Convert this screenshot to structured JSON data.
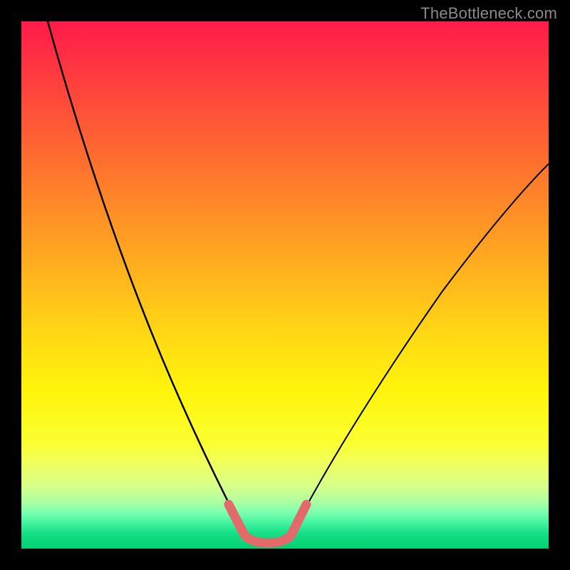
{
  "watermark": "TheBottleneck.com",
  "chart_data": {
    "type": "line",
    "title": "",
    "xlabel": "",
    "ylabel": "",
    "xlim": [
      0,
      100
    ],
    "ylim": [
      0,
      100
    ],
    "series": [
      {
        "name": "left-curve",
        "x": [
          5,
          8,
          12,
          16,
          20,
          24,
          28,
          32,
          35,
          37,
          39,
          40,
          41,
          42
        ],
        "y": [
          100,
          88,
          74,
          62,
          51,
          40,
          30,
          21,
          13,
          9,
          6,
          4,
          3,
          2
        ]
      },
      {
        "name": "right-curve",
        "x": [
          48,
          49,
          50,
          52,
          55,
          60,
          66,
          74,
          82,
          90,
          98,
          100
        ],
        "y": [
          2,
          3,
          4,
          6,
          10,
          17,
          25,
          35,
          45,
          54,
          62,
          64
        ]
      },
      {
        "name": "valley-highlight",
        "x": [
          39,
          40,
          41,
          42,
          43,
          44,
          45,
          46,
          47,
          48,
          49,
          50
        ],
        "y": [
          6,
          4,
          3,
          2,
          2,
          2,
          2,
          2,
          2,
          3,
          4,
          6
        ]
      }
    ],
    "colors": {
      "curve": "#000000",
      "highlight": "#e26a6a",
      "gradient_top": "#ff1a4a",
      "gradient_bottom": "#00d070"
    }
  }
}
